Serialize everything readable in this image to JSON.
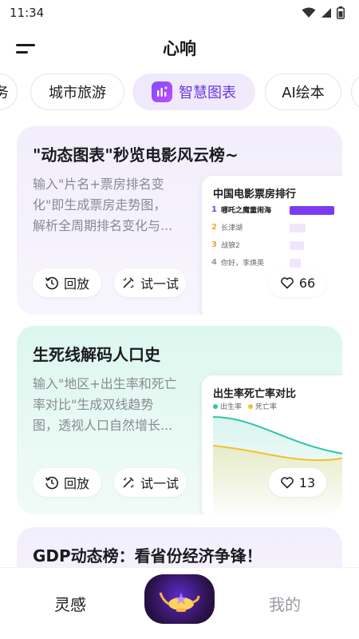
{
  "status": {
    "time": "11:34"
  },
  "app": {
    "title": "心响"
  },
  "tabs": [
    {
      "label": "务"
    },
    {
      "label": "城市旅游"
    },
    {
      "label": "智慧图表",
      "active": true
    },
    {
      "label": "AI绘本"
    },
    {
      "label": ""
    }
  ],
  "cards": [
    {
      "title": "\"动态图表\"秒览电影风云榜~",
      "desc_lines": [
        "输入\"片名+票房排名变",
        "化\"即生成票房走势图，",
        "解析全周期排名变化与..."
      ],
      "replay_label": "回放",
      "try_label": "试一试",
      "likes": "66",
      "preview": {
        "title": "中国电影票房排行",
        "ranks": [
          {
            "num": "1",
            "name": "哪吒之魔童闹海",
            "value": 1.0
          },
          {
            "num": "2",
            "name": "长津湖",
            "value": 0.35
          },
          {
            "num": "3",
            "name": "战狼2",
            "value": 0.33
          },
          {
            "num": "4",
            "name": "你好，李焕英",
            "value": 0.25
          }
        ]
      }
    },
    {
      "title": "生死线解码人口史",
      "desc_lines": [
        "输入\"地区+出生率和死亡",
        "率对比\"生成双线趋势",
        "图，透视人口自然增长..."
      ],
      "replay_label": "回放",
      "try_label": "试一试",
      "likes": "13",
      "preview": {
        "title": "出生率死亡率对比",
        "legend_birth": "出生率",
        "legend_death": "死亡率"
      }
    },
    {
      "title": "GDP动态榜：看省份经济争锋！"
    }
  ],
  "nav": {
    "home_label": "灵感",
    "mine_label": "我的"
  },
  "colors": {
    "accent": "#6b38e0",
    "bar_primary": "#7b3cf0",
    "bar_light": "#efe6fc",
    "birth_line": "#2ec4a8",
    "death_line": "#f2c12e"
  }
}
